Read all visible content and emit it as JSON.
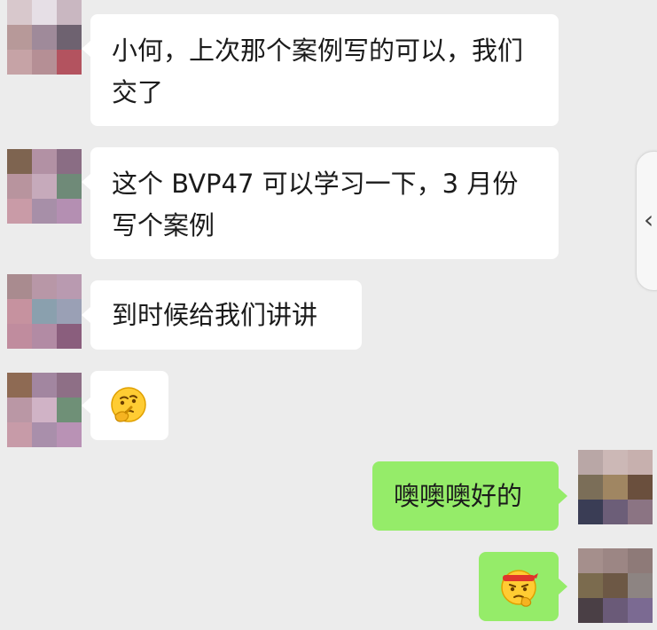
{
  "messages": [
    {
      "side": "left",
      "text": "小何，上次那个案例写的可以，我们交了"
    },
    {
      "side": "left",
      "text": "这个 BVP47 可以学习一下，3 月份写个案例"
    },
    {
      "side": "left",
      "text": "到时候给我们讲讲"
    },
    {
      "side": "left",
      "emoji": "thinking-face-icon"
    },
    {
      "side": "right",
      "text": "噢噢噢好的"
    },
    {
      "side": "right",
      "emoji": "determined-face-headband-icon"
    }
  ],
  "colors": {
    "background": "#ececec",
    "bubble_left": "#ffffff",
    "bubble_right": "#95ec69"
  },
  "icons": {
    "side_handle": "chevron-left-icon",
    "side_handle_glyph": "‹"
  }
}
